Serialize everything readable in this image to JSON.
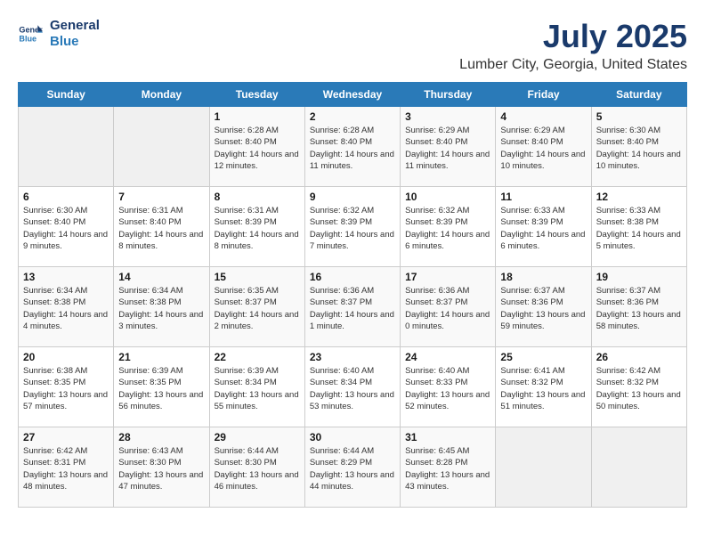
{
  "logo": {
    "line1": "General",
    "line2": "Blue"
  },
  "title": "July 2025",
  "subtitle": "Lumber City, Georgia, United States",
  "days_of_week": [
    "Sunday",
    "Monday",
    "Tuesday",
    "Wednesday",
    "Thursday",
    "Friday",
    "Saturday"
  ],
  "weeks": [
    [
      {
        "day": "",
        "info": ""
      },
      {
        "day": "",
        "info": ""
      },
      {
        "day": "1",
        "info": "Sunrise: 6:28 AM\nSunset: 8:40 PM\nDaylight: 14 hours and 12 minutes."
      },
      {
        "day": "2",
        "info": "Sunrise: 6:28 AM\nSunset: 8:40 PM\nDaylight: 14 hours and 11 minutes."
      },
      {
        "day": "3",
        "info": "Sunrise: 6:29 AM\nSunset: 8:40 PM\nDaylight: 14 hours and 11 minutes."
      },
      {
        "day": "4",
        "info": "Sunrise: 6:29 AM\nSunset: 8:40 PM\nDaylight: 14 hours and 10 minutes."
      },
      {
        "day": "5",
        "info": "Sunrise: 6:30 AM\nSunset: 8:40 PM\nDaylight: 14 hours and 10 minutes."
      }
    ],
    [
      {
        "day": "6",
        "info": "Sunrise: 6:30 AM\nSunset: 8:40 PM\nDaylight: 14 hours and 9 minutes."
      },
      {
        "day": "7",
        "info": "Sunrise: 6:31 AM\nSunset: 8:40 PM\nDaylight: 14 hours and 8 minutes."
      },
      {
        "day": "8",
        "info": "Sunrise: 6:31 AM\nSunset: 8:39 PM\nDaylight: 14 hours and 8 minutes."
      },
      {
        "day": "9",
        "info": "Sunrise: 6:32 AM\nSunset: 8:39 PM\nDaylight: 14 hours and 7 minutes."
      },
      {
        "day": "10",
        "info": "Sunrise: 6:32 AM\nSunset: 8:39 PM\nDaylight: 14 hours and 6 minutes."
      },
      {
        "day": "11",
        "info": "Sunrise: 6:33 AM\nSunset: 8:39 PM\nDaylight: 14 hours and 6 minutes."
      },
      {
        "day": "12",
        "info": "Sunrise: 6:33 AM\nSunset: 8:38 PM\nDaylight: 14 hours and 5 minutes."
      }
    ],
    [
      {
        "day": "13",
        "info": "Sunrise: 6:34 AM\nSunset: 8:38 PM\nDaylight: 14 hours and 4 minutes."
      },
      {
        "day": "14",
        "info": "Sunrise: 6:34 AM\nSunset: 8:38 PM\nDaylight: 14 hours and 3 minutes."
      },
      {
        "day": "15",
        "info": "Sunrise: 6:35 AM\nSunset: 8:37 PM\nDaylight: 14 hours and 2 minutes."
      },
      {
        "day": "16",
        "info": "Sunrise: 6:36 AM\nSunset: 8:37 PM\nDaylight: 14 hours and 1 minute."
      },
      {
        "day": "17",
        "info": "Sunrise: 6:36 AM\nSunset: 8:37 PM\nDaylight: 14 hours and 0 minutes."
      },
      {
        "day": "18",
        "info": "Sunrise: 6:37 AM\nSunset: 8:36 PM\nDaylight: 13 hours and 59 minutes."
      },
      {
        "day": "19",
        "info": "Sunrise: 6:37 AM\nSunset: 8:36 PM\nDaylight: 13 hours and 58 minutes."
      }
    ],
    [
      {
        "day": "20",
        "info": "Sunrise: 6:38 AM\nSunset: 8:35 PM\nDaylight: 13 hours and 57 minutes."
      },
      {
        "day": "21",
        "info": "Sunrise: 6:39 AM\nSunset: 8:35 PM\nDaylight: 13 hours and 56 minutes."
      },
      {
        "day": "22",
        "info": "Sunrise: 6:39 AM\nSunset: 8:34 PM\nDaylight: 13 hours and 55 minutes."
      },
      {
        "day": "23",
        "info": "Sunrise: 6:40 AM\nSunset: 8:34 PM\nDaylight: 13 hours and 53 minutes."
      },
      {
        "day": "24",
        "info": "Sunrise: 6:40 AM\nSunset: 8:33 PM\nDaylight: 13 hours and 52 minutes."
      },
      {
        "day": "25",
        "info": "Sunrise: 6:41 AM\nSunset: 8:32 PM\nDaylight: 13 hours and 51 minutes."
      },
      {
        "day": "26",
        "info": "Sunrise: 6:42 AM\nSunset: 8:32 PM\nDaylight: 13 hours and 50 minutes."
      }
    ],
    [
      {
        "day": "27",
        "info": "Sunrise: 6:42 AM\nSunset: 8:31 PM\nDaylight: 13 hours and 48 minutes."
      },
      {
        "day": "28",
        "info": "Sunrise: 6:43 AM\nSunset: 8:30 PM\nDaylight: 13 hours and 47 minutes."
      },
      {
        "day": "29",
        "info": "Sunrise: 6:44 AM\nSunset: 8:30 PM\nDaylight: 13 hours and 46 minutes."
      },
      {
        "day": "30",
        "info": "Sunrise: 6:44 AM\nSunset: 8:29 PM\nDaylight: 13 hours and 44 minutes."
      },
      {
        "day": "31",
        "info": "Sunrise: 6:45 AM\nSunset: 8:28 PM\nDaylight: 13 hours and 43 minutes."
      },
      {
        "day": "",
        "info": ""
      },
      {
        "day": "",
        "info": ""
      }
    ]
  ]
}
